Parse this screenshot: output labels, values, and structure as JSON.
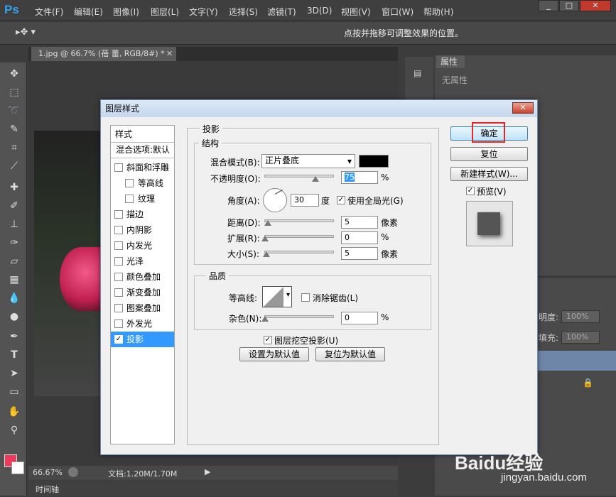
{
  "app": {
    "logo": "Ps",
    "menus": [
      "文件(F)",
      "编辑(E)",
      "图像(I)",
      "图层(L)",
      "文字(Y)",
      "选择(S)",
      "滤镜(T)",
      "3D(D)",
      "视图(V)",
      "窗口(W)",
      "帮助(H)"
    ],
    "window_controls": [
      "_",
      "□",
      "✕"
    ]
  },
  "options_bar": {
    "hint": "点按并拖移可调整效果的位置。"
  },
  "document": {
    "tab_title": "1.jpg @ 66.7% (蓓 蕾, RGB/8#) *",
    "tab_close": "✕",
    "zoom": "66.67%",
    "doc_size": "文档:1.20M/1.70M",
    "timeline_label": "时间轴"
  },
  "colors": {
    "foreground": "#ef3a5d",
    "background": "#ffffff",
    "accent": "#3399ff"
  },
  "properties_panel": {
    "tab": "属性",
    "empty_text": "无属性"
  },
  "layers_panel": {
    "opacity_label": "明度:",
    "opacity_value": "100%",
    "fill_label": "填充:",
    "fill_value": "100%"
  },
  "dialog": {
    "title": "图层样式",
    "close": "✕",
    "style_list": {
      "header": "样式",
      "blend_options": "混合选项:默认",
      "items": [
        {
          "label": "斜面和浮雕",
          "checked": false,
          "indent": false
        },
        {
          "label": "等高线",
          "checked": false,
          "indent": true
        },
        {
          "label": "纹理",
          "checked": false,
          "indent": true
        },
        {
          "label": "描边",
          "checked": false,
          "indent": false
        },
        {
          "label": "内阴影",
          "checked": false,
          "indent": false
        },
        {
          "label": "内发光",
          "checked": false,
          "indent": false
        },
        {
          "label": "光泽",
          "checked": false,
          "indent": false
        },
        {
          "label": "颜色叠加",
          "checked": false,
          "indent": false
        },
        {
          "label": "渐变叠加",
          "checked": false,
          "indent": false
        },
        {
          "label": "图案叠加",
          "checked": false,
          "indent": false
        },
        {
          "label": "外发光",
          "checked": false,
          "indent": false
        },
        {
          "label": "投影",
          "checked": true,
          "indent": false,
          "selected": true
        }
      ]
    },
    "drop_shadow": {
      "section_title": "投影",
      "structure_title": "结构",
      "blend_mode_label": "混合模式(B):",
      "blend_mode_value": "正片叠底",
      "shadow_color": "#000000",
      "opacity_label": "不透明度(O):",
      "opacity_value": "75",
      "opacity_unit": "%",
      "angle_label": "角度(A):",
      "angle_value": "30",
      "angle_unit": "度",
      "global_light_label": "使用全局光(G)",
      "distance_label": "距离(D):",
      "distance_value": "5",
      "distance_unit": "像素",
      "spread_label": "扩展(R):",
      "spread_value": "0",
      "spread_unit": "%",
      "size_label": "大小(S):",
      "size_value": "5",
      "size_unit": "像素",
      "quality_title": "品质",
      "contour_label": "等高线:",
      "antialias_label": "消除锯齿(L)",
      "noise_label": "杂色(N):",
      "noise_value": "0",
      "noise_unit": "%",
      "knockout_label": "图层挖空投影(U)",
      "set_default": "设置为默认值",
      "reset_default": "复位为默认值"
    },
    "buttons": {
      "ok": "确定",
      "reset": "复位",
      "new_style": "新建样式(W)...",
      "preview": "预览(V)"
    }
  },
  "watermark": {
    "brand": "Baidu经验",
    "url": "jingyan.baidu.com"
  }
}
